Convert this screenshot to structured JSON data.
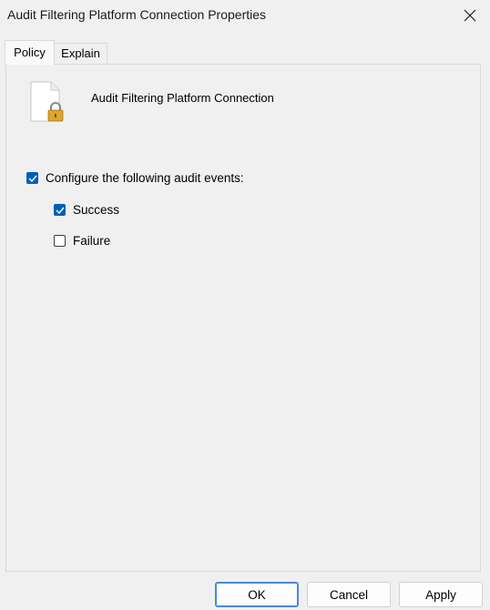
{
  "window": {
    "title": "Audit Filtering Platform Connection Properties"
  },
  "tabs": [
    {
      "label": "Policy",
      "active": true
    },
    {
      "label": "Explain",
      "active": false
    }
  ],
  "policy": {
    "name": "Audit Filtering Platform Connection",
    "icon": "document-lock-icon"
  },
  "options": {
    "configure": {
      "label": "Configure the following audit events:",
      "checked": true
    },
    "success": {
      "label": "Success",
      "checked": true
    },
    "failure": {
      "label": "Failure",
      "checked": false
    }
  },
  "buttons": {
    "ok": "OK",
    "cancel": "Cancel",
    "apply": "Apply"
  },
  "colors": {
    "accent": "#005fb8"
  }
}
